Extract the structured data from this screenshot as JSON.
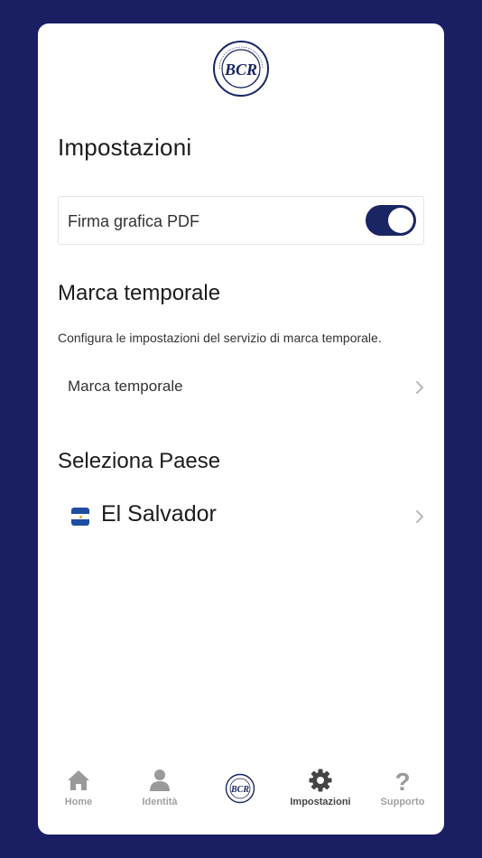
{
  "logo": {
    "name": "bcr-logo-icon",
    "text": "BCR",
    "ring_text": "BANCO CENTRAL DE RESERVA DE EL SALVADOR"
  },
  "page": {
    "title": "Impostazioni"
  },
  "pdf_signature": {
    "label": "Firma grafica PDF",
    "enabled": true
  },
  "timestamp": {
    "section_title": "Marca temporale",
    "description": "Configura le impostazioni del servizio di marca temporale.",
    "item_label": "Marca temporale"
  },
  "country": {
    "section_title": "Seleziona Paese",
    "selected": "El Salvador",
    "flag_icon": "el-salvador-flag-icon"
  },
  "tabbar": {
    "home": "Home",
    "identity": "Identità",
    "settings": "Impostazioni",
    "support": "Supporto",
    "active": "settings"
  },
  "colors": {
    "background": "#1a1f64",
    "accent": "#1a2563",
    "card": "#ffffff"
  }
}
